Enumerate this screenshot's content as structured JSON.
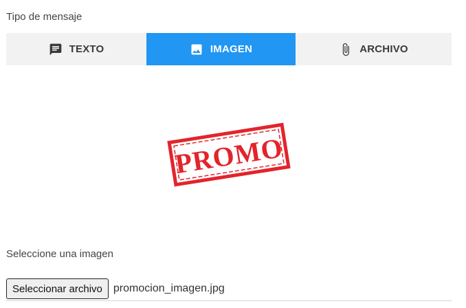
{
  "message_type": {
    "label": "Tipo de mensaje",
    "tabs": [
      {
        "label": "TEXTO",
        "icon": "message-icon",
        "active": false
      },
      {
        "label": "IMAGEN",
        "icon": "image-icon",
        "active": true
      },
      {
        "label": "ARCHIVO",
        "icon": "paperclip-icon",
        "active": false
      }
    ]
  },
  "preview": {
    "stamp_text": "PROMO",
    "stamp_color": "#e3242b"
  },
  "image_select": {
    "label": "Seleccione una imagen",
    "button_label": "Seleccionar archivo",
    "file_name": "promocion_imagen.jpg"
  },
  "colors": {
    "accent": "#2196f3",
    "tab_bg": "#f2f2f2"
  }
}
